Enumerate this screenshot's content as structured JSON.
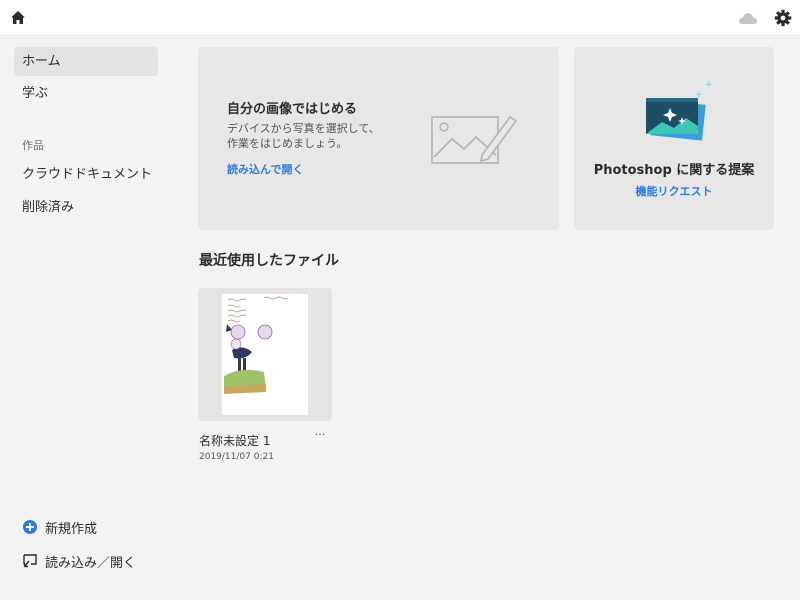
{
  "topbar": {
    "icons": [
      "home-icon",
      "cloud-icon",
      "gear-icon"
    ]
  },
  "sidebar": {
    "items": [
      {
        "label": "ホーム",
        "active": true
      },
      {
        "label": "学ぶ",
        "active": false
      }
    ],
    "section_label": "作品",
    "section_items": [
      {
        "label": "クラウドドキュメント"
      },
      {
        "label": "削除済み"
      }
    ],
    "actions": {
      "new_label": "新規作成",
      "open_label": "読み込み／開く"
    }
  },
  "start_card": {
    "title": "自分の画像ではじめる",
    "desc_line1": "デバイスから写真を選択して、",
    "desc_line2": "作業をはじめましょう。",
    "link": "読み込んで開く",
    "icon": "image-edit-icon"
  },
  "suggest_card": {
    "title": "Photoshop に関する提案",
    "link": "機能リクエスト",
    "icon": "feature-request-illustration"
  },
  "recent": {
    "title": "最近使用したファイル",
    "files": [
      {
        "name": "名称未設定 1",
        "date": "2019/11/07 0:21",
        "more": "···"
      }
    ]
  },
  "colors": {
    "accent": "#2d7be0",
    "background": "#f3f3f3",
    "card": "#e7e7e7"
  }
}
